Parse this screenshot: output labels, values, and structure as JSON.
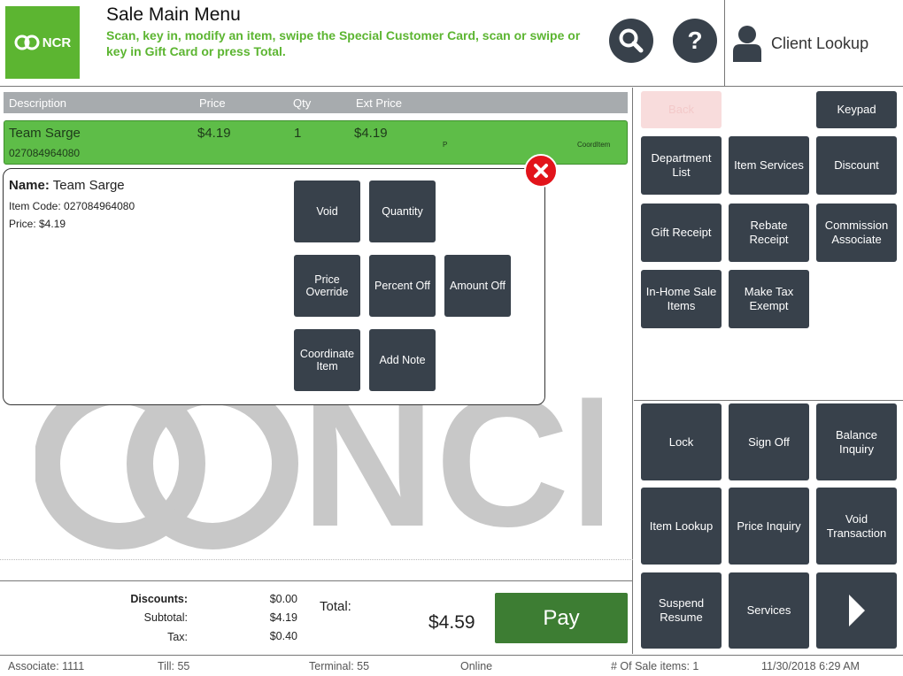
{
  "header": {
    "logo_text": "NCR",
    "title": "Sale Main Menu",
    "subtitle": "Scan, key in, modify an item, swipe the Special Customer Card, scan or swipe or key in Gift Card or press Total.",
    "help_glyph": "?",
    "client_lookup_label": "Client Lookup",
    "icons": [
      "search-icon",
      "help-icon",
      "person-icon"
    ]
  },
  "table": {
    "columns": [
      "Description",
      "Price",
      "Qty",
      "Ext Price"
    ]
  },
  "item": {
    "description": "Team Sarge",
    "price": "$4.19",
    "qty": "1",
    "ext_price": "$4.19",
    "code": "027084964080",
    "flag": "P",
    "tag": "CoordItem"
  },
  "popup": {
    "name_label": "Name:",
    "name": "Team Sarge",
    "item_code_line": "Item Code: 027084964080",
    "price_line": "Price: $4.19",
    "buttons": [
      "Void",
      "Quantity",
      "Price Override",
      "Percent Off",
      "Amount Off",
      "Coordinate Item",
      "Add Note"
    ]
  },
  "totals": {
    "discounts_label": "Discounts:",
    "discounts": "$0.00",
    "subtotal_label": "Subtotal:",
    "subtotal": "$4.19",
    "tax_label": "Tax:",
    "tax": "$0.40",
    "total_label": "Total:",
    "total": "$4.59",
    "pay_label": "Pay"
  },
  "right_top": {
    "back": "Back",
    "keypad": "Keypad",
    "buttons": [
      "Department List",
      "Item Services",
      "Discount",
      "Gift Receipt",
      "Rebate Receipt",
      "Commission Associate",
      "In-Home Sale Items",
      "Make Tax Exempt"
    ]
  },
  "right_bottom": {
    "buttons": [
      "Lock",
      "Sign Off",
      "Balance Inquiry",
      "Item Lookup",
      "Price Inquiry",
      "Void Transaction",
      "Suspend Resume",
      "Services"
    ],
    "next_icon": "chevron-right-icon"
  },
  "status": {
    "associate": "Associate: 1111",
    "till": "Till: 55",
    "terminal": "Terminal: 55",
    "online": "Online",
    "sale_items": "# Of Sale items: 1",
    "datetime": "11/30/2018 6:29 AM"
  },
  "colors": {
    "brand_green": "#5cb531",
    "row_green": "#5ebd48",
    "button_dark": "#38414b",
    "pay_green": "#3d7d33",
    "close_red": "#e2141b"
  }
}
